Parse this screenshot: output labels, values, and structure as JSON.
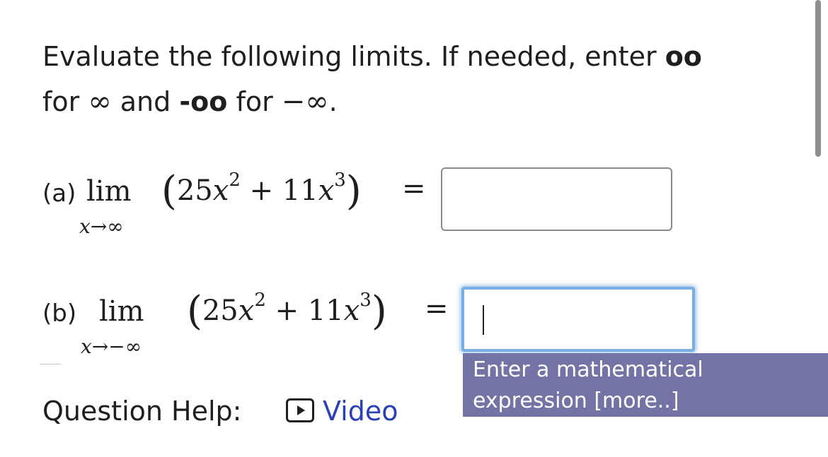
{
  "instructions": {
    "line1": "Evaluate the following limits. If needed, enter ",
    "oo": "oo",
    "for": "for",
    "infinity": "∞",
    "and": "and",
    "neg_oo": "-oo",
    "neg_infinity": "−∞",
    "period": "."
  },
  "part_a": {
    "label": "(a)",
    "lim": "lim",
    "limit_var": "x",
    "arrow": "→",
    "limit_to": "∞",
    "paren_open": "(",
    "coef1": "25",
    "var": "x",
    "exp1": "2",
    "plus": "+",
    "coef2": "11",
    "exp2": "3",
    "paren_close": ")",
    "equals": "=",
    "answer_value": ""
  },
  "part_b": {
    "label": "(b)",
    "lim": "lim",
    "limit_var": "x",
    "arrow": "→",
    "limit_to": "−∞",
    "paren_open": "(",
    "coef1": "25",
    "var": "x",
    "exp1": "2",
    "plus": "+",
    "coef2": "11",
    "exp2": "3",
    "paren_close": ")",
    "equals": "=",
    "answer_value": ""
  },
  "tooltip": {
    "line1": "Enter a mathematical",
    "line2": "expression [more..]"
  },
  "help": {
    "label": "Question Help:",
    "video_label": "Video"
  },
  "colors": {
    "text": "#1f1f1f",
    "link": "#2a40b8",
    "focus_border": "#7aaee2",
    "tooltip_bg": "#7373a5"
  }
}
